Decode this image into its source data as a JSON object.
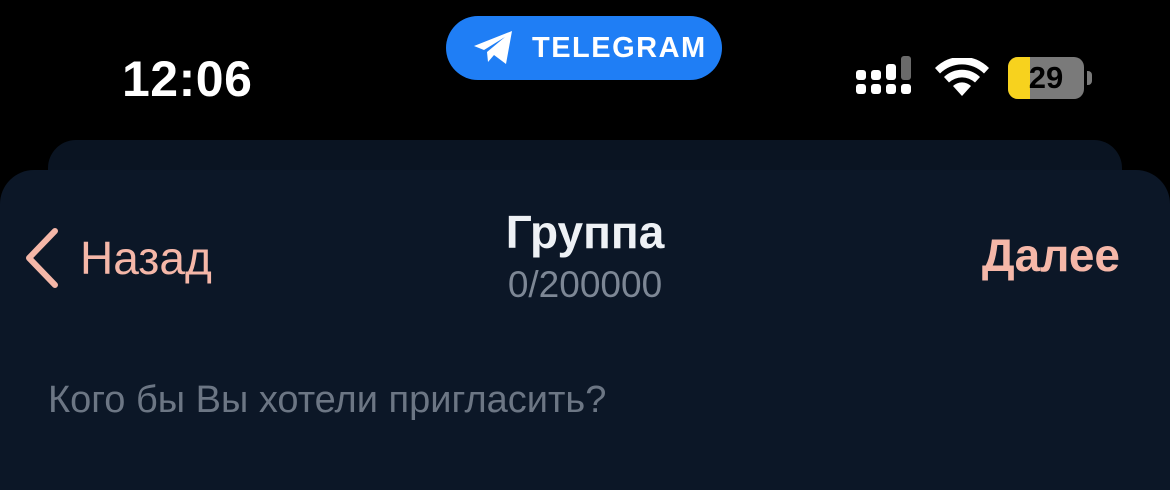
{
  "status_bar": {
    "time": "12:06",
    "app_pill_label": "TELEGRAM",
    "battery_level": "29",
    "battery_fraction": 0.29,
    "signal_icon": "cellular-signal-icon",
    "wifi_icon": "wifi-icon",
    "pill_icon": "telegram-plane-icon"
  },
  "header": {
    "back_label": "Назад",
    "title": "Группа",
    "subtitle": "0/200000",
    "next_label": "Далее"
  },
  "search": {
    "placeholder": "Кого бы Вы хотели пригласить?",
    "value": ""
  },
  "colors": {
    "accent": "#f5b7a8",
    "pill": "#1f7ef5",
    "sheet_bg": "#0c1727",
    "battery_fill": "#f7d21e"
  }
}
